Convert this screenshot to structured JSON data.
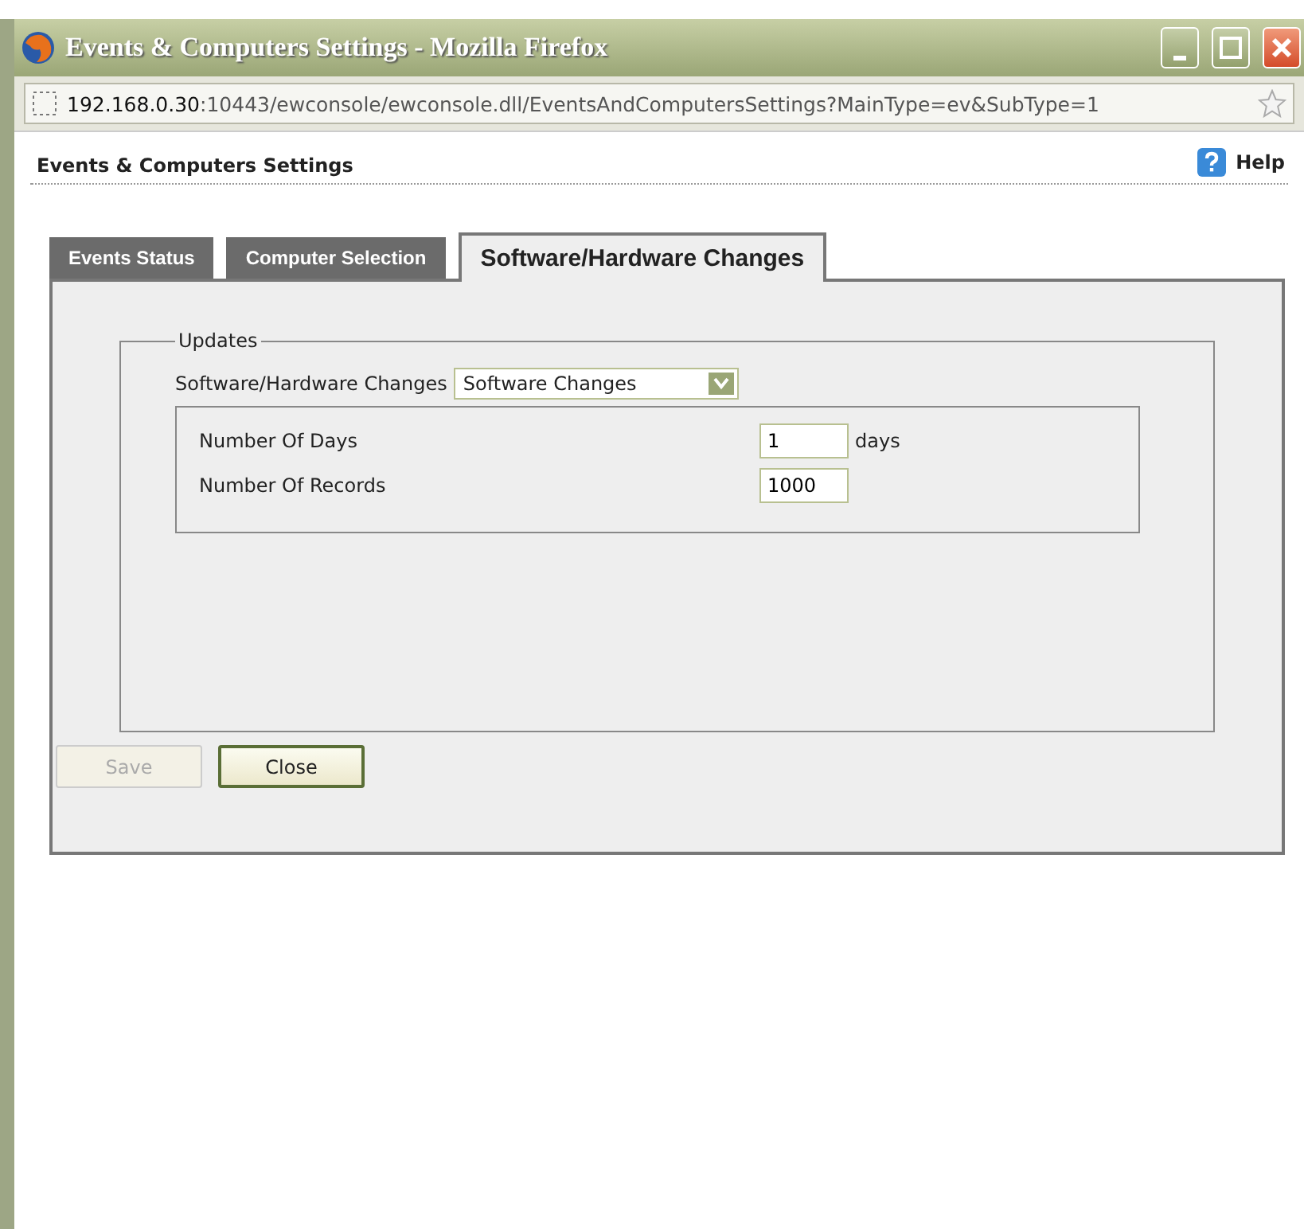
{
  "window": {
    "title": "Events & Computers Settings - Mozilla Firefox"
  },
  "address_bar": {
    "host": "192.168.0.30",
    "path": ":10443/ewconsole/ewconsole.dll/EventsAndComputersSettings?MainType=ev&SubType=1"
  },
  "page": {
    "title": "Events & Computers Settings",
    "help": "Help"
  },
  "tabs": [
    {
      "label": "Events Status",
      "selected": false
    },
    {
      "label": "Computer Selection",
      "selected": false
    },
    {
      "label": "Software/Hardware Changes",
      "selected": true
    }
  ],
  "group": {
    "legend": "Updates",
    "select_label": "Software/Hardware Changes",
    "select_value": "Software Changes",
    "fields": [
      {
        "label": "Number Of Days",
        "value": "1",
        "unit": "days"
      },
      {
        "label": "Number Of Records",
        "value": "1000"
      }
    ]
  },
  "buttons": [
    {
      "label": "Save",
      "disabled": true
    },
    {
      "label": "Close",
      "disabled": false
    }
  ]
}
